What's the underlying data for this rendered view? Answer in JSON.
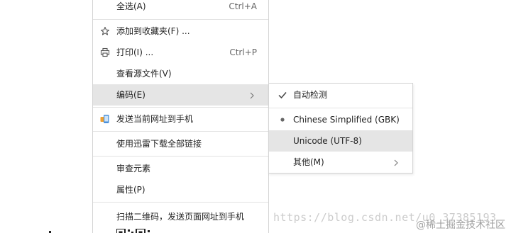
{
  "context_menu": {
    "items": [
      {
        "label": "全选(A)",
        "shortcut": "Ctrl+A"
      },
      {
        "label": "添加到收藏夹(F) ...",
        "icon": "star-icon"
      },
      {
        "label": "打印(I) ...",
        "shortcut": "Ctrl+P",
        "icon": "printer-icon"
      },
      {
        "label": "查看源文件(V)"
      },
      {
        "label": "编码(E)",
        "has_submenu": true,
        "highlighted": true
      },
      {
        "label": "发送当前网址到手机",
        "icon": "phone-send-icon"
      },
      {
        "label": "使用迅雷下载全部链接"
      },
      {
        "label": "审查元素"
      },
      {
        "label": "属性(P)"
      },
      {
        "label": "扫描二维码，发送页面网址到手机",
        "icon": "qr-code-icon"
      }
    ]
  },
  "encoding_submenu": {
    "items": [
      {
        "label": "自动检测",
        "mark": "check-icon"
      },
      {
        "label": "Chinese Simplified (GBK)",
        "mark": "radio-dot-icon"
      },
      {
        "label": "Unicode (UTF-8)",
        "highlighted": true
      },
      {
        "label": "其他(M)",
        "has_submenu": true
      }
    ]
  },
  "watermark": {
    "url_text": "https://blog.csdn.net/u0_37385193",
    "site_text": "@稀土掘金技术社区"
  },
  "colors": {
    "highlight": "#e5e5e5",
    "border": "#d4d4d4",
    "text": "#222222",
    "shortcut": "#666666"
  }
}
